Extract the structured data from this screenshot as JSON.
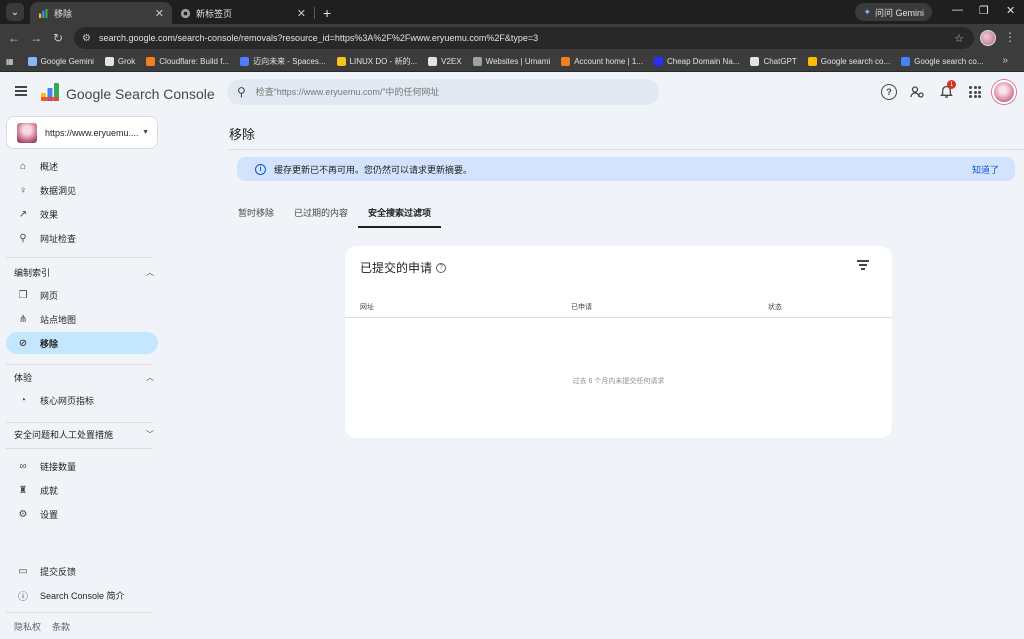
{
  "browser": {
    "tabs": [
      {
        "title": "移除",
        "active": true
      },
      {
        "title": "新标签页",
        "active": false
      }
    ],
    "new_tab": "+",
    "gemini_label": "问问 Gemini",
    "controls": {
      "minimize": "—",
      "restore": "❐",
      "close": "✕"
    },
    "nav": {
      "back": "←",
      "forward": "→",
      "reload": "↻"
    },
    "url": "search.google.com/search-console/removals?resource_id=https%3A%2F%2Fwww.eryuemu.com%2F&type=3",
    "bookmarks": [
      {
        "label": "Google Gemini",
        "color": "#8ab4f8"
      },
      {
        "label": "Grok",
        "color": "#e3e3e3"
      },
      {
        "label": "Cloudflare: Build f...",
        "color": "#f38020"
      },
      {
        "label": "迈向未来 - Spaces...",
        "color": "#4f7bff"
      },
      {
        "label": "LINUX DO - 新的...",
        "color": "#f5c518"
      },
      {
        "label": "V2EX",
        "color": "#e3e3e3"
      },
      {
        "label": "Websites | Umami",
        "color": "#9aa0a6"
      },
      {
        "label": "Account home | 1...",
        "color": "#f38020"
      },
      {
        "label": "Cheap Domain Na...",
        "color": "#2c2cff"
      },
      {
        "label": "ChatGPT",
        "color": "#e3e3e3"
      },
      {
        "label": "Google search co...",
        "color": "#fbbc04"
      },
      {
        "label": "Google search co...",
        "color": "#4285f4"
      }
    ],
    "more": "»"
  },
  "header": {
    "brand": "Google Search Console",
    "search_placeholder": "检查“https://www.eryuemu.com/”中的任何网址",
    "notification_count": "1"
  },
  "sidebar": {
    "property_url": "https://www.eryuemu....",
    "items_top": [
      {
        "label": "概述",
        "icon": "home-icon"
      },
      {
        "label": "数据洞见",
        "icon": "bulb-icon"
      },
      {
        "label": "效果",
        "icon": "trending-icon"
      },
      {
        "label": "网址检查",
        "icon": "search-icon"
      }
    ],
    "section_index": "编制索引",
    "items_index": [
      {
        "label": "网页",
        "icon": "pages-icon"
      },
      {
        "label": "站点地图",
        "icon": "sitemap-icon"
      },
      {
        "label": "移除",
        "icon": "eye-off-icon",
        "selected": true
      }
    ],
    "section_experience": "体验",
    "items_experience": [
      {
        "label": "核心网页指标",
        "icon": "gauge-icon"
      }
    ],
    "section_security": "安全问题和人工处置措施",
    "items_bottom": [
      {
        "label": "链接数量",
        "icon": "link-icon"
      },
      {
        "label": "成就",
        "icon": "trophy-icon"
      },
      {
        "label": "设置",
        "icon": "gear-icon"
      }
    ],
    "items_footer": [
      {
        "label": "提交反馈",
        "icon": "feedback-icon"
      },
      {
        "label": "Search Console 简介",
        "icon": "info-icon"
      }
    ],
    "links": [
      "隐私权",
      "条款"
    ]
  },
  "main": {
    "title": "移除",
    "banner_text": "缓存更新已不再可用。您仍然可以请求更新摘要。",
    "banner_action": "知道了",
    "tabs": [
      "暂时移除",
      "已过期的内容",
      "安全搜索过滤项"
    ],
    "card": {
      "title": "已提交的申请",
      "columns": [
        "网址",
        "已申请",
        "状态"
      ],
      "empty": "过去 6 个月内未提交任何请求"
    }
  },
  "colors": {
    "accent": "#0b57d0",
    "selected_bg": "#c2e7ff",
    "banner_bg": "#d3e3fd"
  }
}
